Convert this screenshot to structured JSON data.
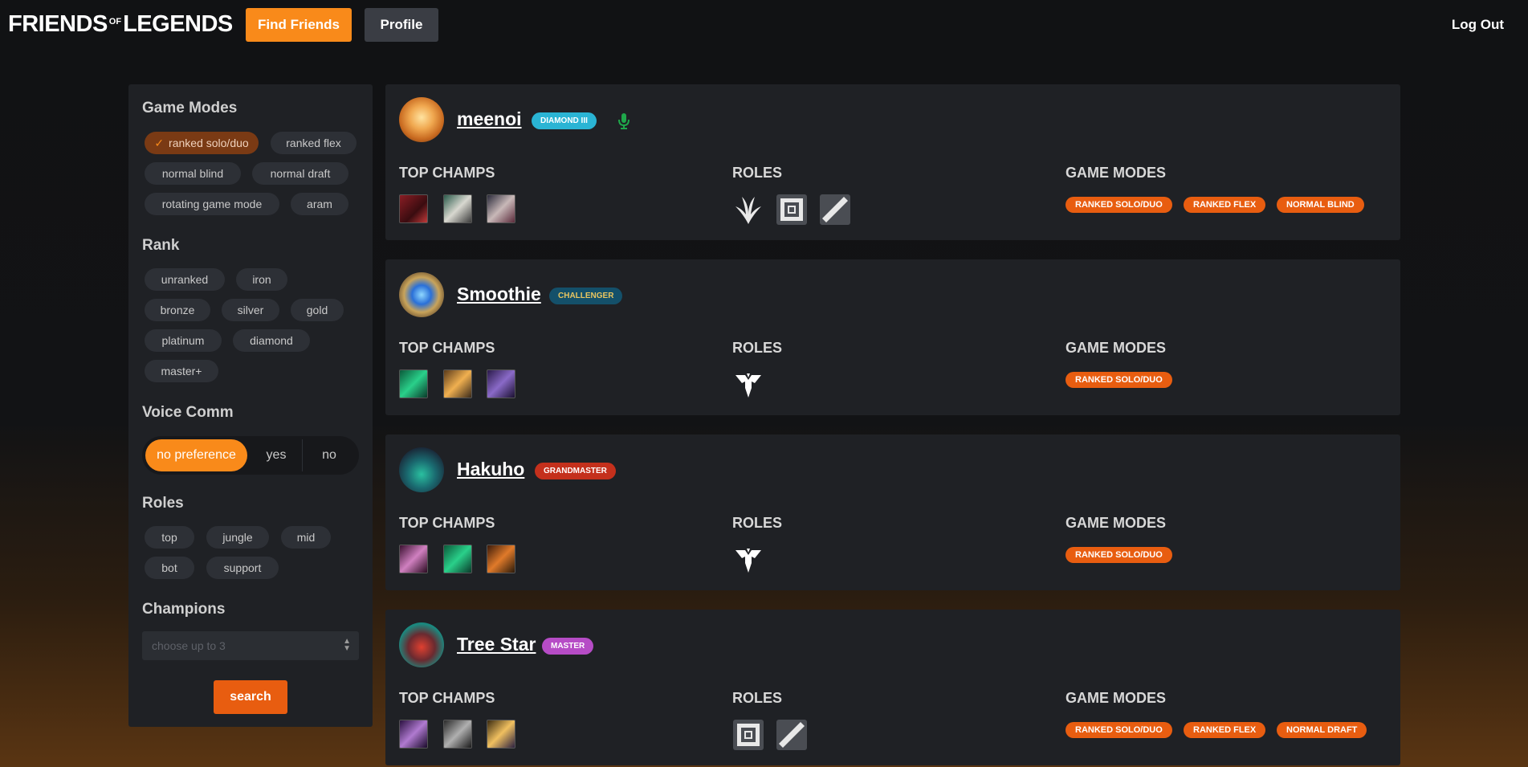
{
  "brand": {
    "left": "FRIENDS",
    "of": "OF",
    "right": "LEGENDS"
  },
  "nav": {
    "find_friends": "Find Friends",
    "profile": "Profile",
    "logout": "Log Out"
  },
  "colors": {
    "accent": "#f98a1a",
    "accent_dark": "#e85d10",
    "panel": "#1f2125",
    "background": "#121315"
  },
  "filters": {
    "game_modes_title": "Game Modes",
    "game_modes": [
      {
        "label": "ranked solo/duo",
        "selected": true
      },
      {
        "label": "ranked flex",
        "selected": false
      },
      {
        "label": "normal blind",
        "selected": false
      },
      {
        "label": "normal draft",
        "selected": false
      },
      {
        "label": "rotating game mode",
        "selected": false
      },
      {
        "label": "aram",
        "selected": false
      }
    ],
    "rank_title": "Rank",
    "ranks": [
      "unranked",
      "iron",
      "bronze",
      "silver",
      "gold",
      "platinum",
      "diamond",
      "master+"
    ],
    "voice_title": "Voice Comm",
    "voice_options": [
      "no preference",
      "yes",
      "no"
    ],
    "voice_selected": "no preference",
    "roles_title": "Roles",
    "roles": [
      "top",
      "jungle",
      "mid",
      "bot",
      "support"
    ],
    "champions_title": "Champions",
    "champions_placeholder": "choose up to 3",
    "search_label": "search"
  },
  "columns": {
    "top_champs": "TOP CHAMPS",
    "roles": "ROLES",
    "game_modes": "GAME MODES"
  },
  "players": [
    {
      "name": "meenoi",
      "rank": "DIAMOND III",
      "rank_bg": "#2ab4d4",
      "rank_fg": "#ffffff",
      "voice": "mic-icon",
      "champion_icons": [
        "champion-portrait-red-hair",
        "champion-portrait-white-mask",
        "champion-portrait-pale"
      ],
      "roles": [
        "jungle-role-icon",
        "mid-role-icon",
        "bot-role-icon"
      ],
      "game_modes": [
        "RANKED SOLO/DUO",
        "RANKED FLEX",
        "NORMAL BLIND"
      ]
    },
    {
      "name": "Smoothie",
      "rank": "CHALLENGER",
      "rank_bg": "#14506a",
      "rank_fg": "#e8c560",
      "voice": "",
      "champion_icons": [
        "champion-portrait-green",
        "champion-portrait-gold",
        "champion-portrait-purple"
      ],
      "roles": [
        "support-role-icon"
      ],
      "game_modes": [
        "RANKED SOLO/DUO"
      ]
    },
    {
      "name": "Hakuho",
      "rank": "GRANDMASTER",
      "rank_bg": "#c4301c",
      "rank_fg": "#ffffff",
      "voice": "",
      "champion_icons": [
        "champion-portrait-dark-pink",
        "champion-portrait-green-face",
        "champion-portrait-fire"
      ],
      "roles": [
        "support-role-icon"
      ],
      "game_modes": [
        "RANKED SOLO/DUO"
      ]
    },
    {
      "name": "Tree Star",
      "rank": "MASTER",
      "rank_bg": "#b64cc6",
      "rank_fg": "#ffffff",
      "voice": "",
      "champion_icons": [
        "champion-portrait-purple-hair",
        "champion-portrait-grey",
        "champion-portrait-gold-armor"
      ],
      "roles": [
        "mid-role-icon",
        "bot-role-icon"
      ],
      "game_modes": [
        "RANKED SOLO/DUO",
        "RANKED FLEX",
        "NORMAL DRAFT"
      ]
    }
  ]
}
